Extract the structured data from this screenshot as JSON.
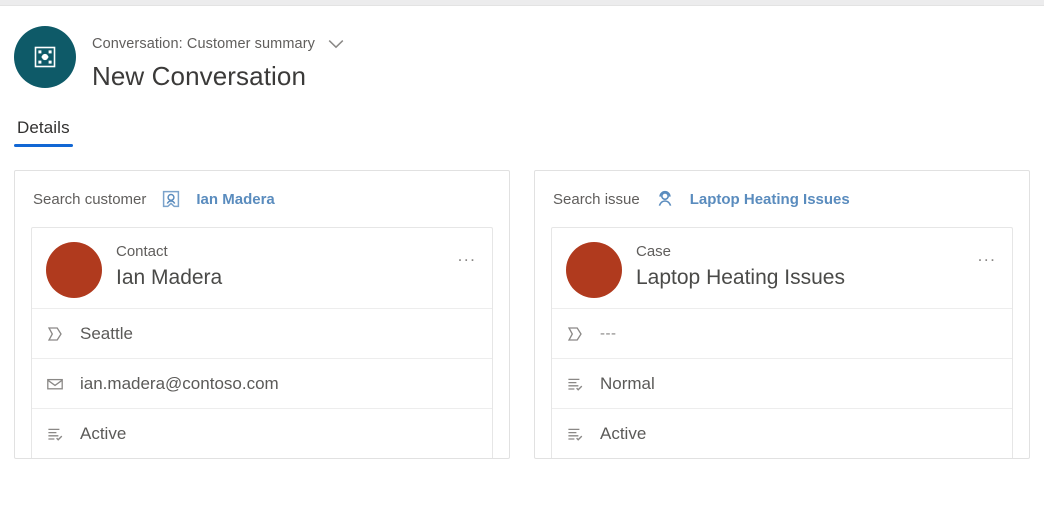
{
  "header": {
    "entity_icon": "conversation-icon",
    "avatar_color": "#0e5a68",
    "breadcrumb": "Conversation: Customer summary",
    "chevron_icon": "chevron-down-icon",
    "title": "New Conversation"
  },
  "tabs": [
    {
      "label": "Details",
      "active": true
    }
  ],
  "accent": {
    "tab_underline": "#1267d4",
    "link": "#5a8cbe",
    "avatar_red": "#b03a1e"
  },
  "cards": [
    {
      "search": {
        "label": "Search customer",
        "icon": "contact-card-icon",
        "value": "Ian Madera"
      },
      "record": {
        "type": "Contact",
        "name": "Ian Madera",
        "overflow_label": "...",
        "fields": [
          {
            "icon": "address-icon",
            "value": "Seattle",
            "muted": false
          },
          {
            "icon": "email-icon",
            "value": "ian.madera@contoso.com",
            "muted": false
          },
          {
            "icon": "status-icon",
            "value": "Active",
            "muted": false
          }
        ]
      }
    },
    {
      "search": {
        "label": "Search issue",
        "icon": "case-agent-icon",
        "value": "Laptop Heating Issues"
      },
      "record": {
        "type": "Case",
        "name": "Laptop Heating Issues",
        "overflow_label": "...",
        "fields": [
          {
            "icon": "address-icon",
            "value": "---",
            "muted": true
          },
          {
            "icon": "status-icon",
            "value": "Normal",
            "muted": false
          },
          {
            "icon": "status-icon",
            "value": "Active",
            "muted": false
          }
        ]
      }
    }
  ]
}
